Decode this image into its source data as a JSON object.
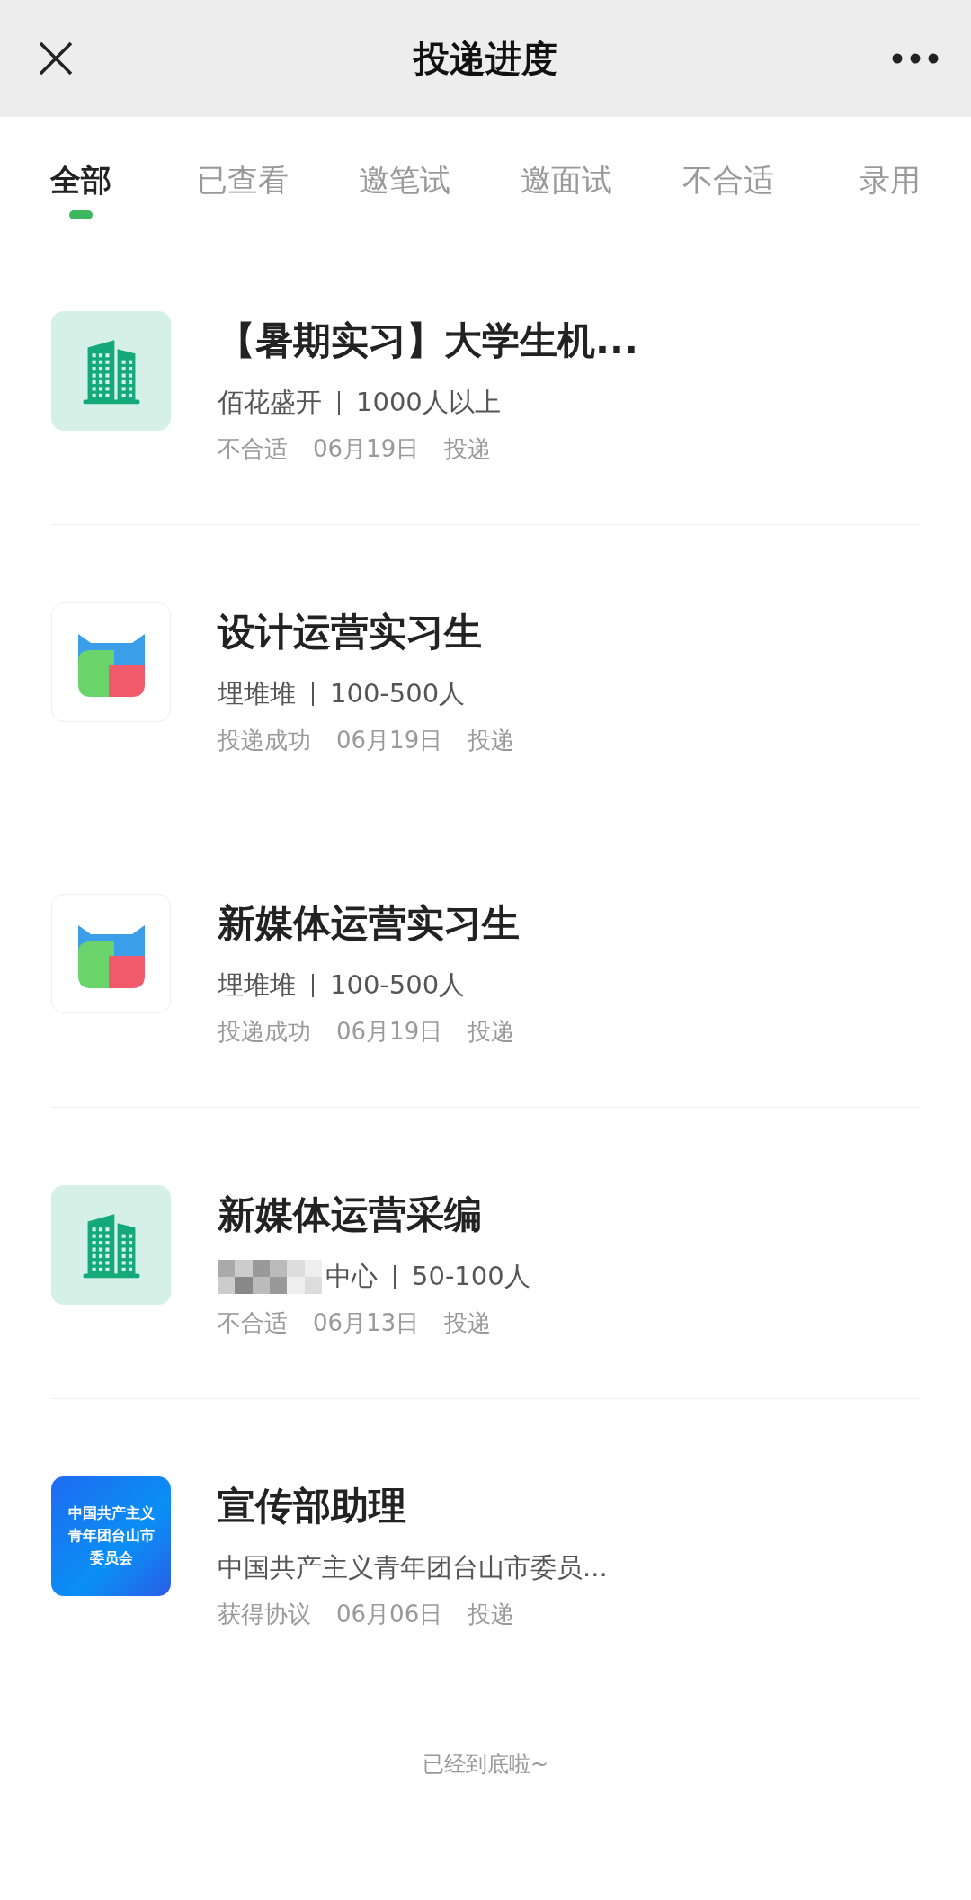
{
  "header": {
    "title": "投递进度"
  },
  "tabs": [
    {
      "label": "全部",
      "selected": true
    },
    {
      "label": "已查看",
      "selected": false
    },
    {
      "label": "邀笔试",
      "selected": false
    },
    {
      "label": "邀面试",
      "selected": false
    },
    {
      "label": "不合适",
      "selected": false
    },
    {
      "label": "录用",
      "selected": false
    }
  ],
  "applications": [
    {
      "title": "【暑期实习】大学生机...",
      "company": "佰花盛开",
      "size": "1000人以上",
      "status": "不合适",
      "date": "06月19日",
      "action": "投递",
      "logo": {
        "kind": "building"
      }
    },
    {
      "title": "设计运营实习生",
      "company": "埋堆堆",
      "size": "100-500人",
      "status": "投递成功",
      "date": "06月19日",
      "action": "投递",
      "logo": {
        "kind": "app"
      }
    },
    {
      "title": "新媒体运营实习生",
      "company": "埋堆堆",
      "size": "100-500人",
      "status": "投递成功",
      "date": "06月19日",
      "action": "投递",
      "logo": {
        "kind": "app"
      }
    },
    {
      "title": "新媒体运营采编",
      "company": "中心",
      "company_redacted": true,
      "size": "50-100人",
      "status": "不合适",
      "date": "06月13日",
      "action": "投递",
      "logo": {
        "kind": "building"
      }
    },
    {
      "title": "宣传部助理",
      "company": "中国共产主义青年团台山市委员...",
      "status": "获得协议",
      "date": "06月06日",
      "action": "投递",
      "logo": {
        "kind": "text",
        "lines": [
          "中国共产主义",
          "青年团台山市",
          "委员会"
        ]
      }
    }
  ],
  "footer": "已经到底啦~"
}
